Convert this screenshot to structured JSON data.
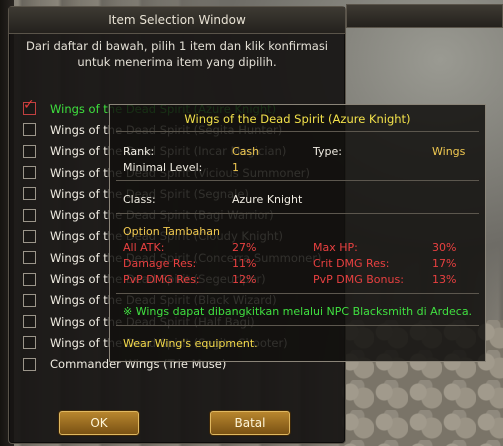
{
  "window": {
    "title": "Item Selection Window",
    "instructions": "Dari daftar di bawah, pilih 1 item dan klik konfirmasi untuk menerima item yang dipilih.",
    "items": [
      {
        "label": "Wings of the Dead Spirit (Azure Knight)",
        "checked": true
      },
      {
        "label": "Wings of the Dead Spirit (Segita Hunter)",
        "checked": false
      },
      {
        "label": "Wings of the Dead Spirit (Incar Magician)",
        "checked": false
      },
      {
        "label": "Wings of the Dead Spirit (Vicious Summoner)",
        "checked": false
      },
      {
        "label": "Wings of the Dead Spirit (Segnale)",
        "checked": false
      },
      {
        "label": "Wings of the Dead Spirit (Bagi Warrior)",
        "checked": false
      },
      {
        "label": "Wings of the Dead Spirit (Cloudy Knight)",
        "checked": false
      },
      {
        "label": "Wings of the Dead Spirit (Concerra Summoner)",
        "checked": false
      },
      {
        "label": "Wings of the Dead Spirit (Segeuriper)",
        "checked": false
      },
      {
        "label": "Wings of the Dead Spirit (Black Wizard)",
        "checked": false
      },
      {
        "label": "Wings of the Dead Spirit (Half Bagi)",
        "checked": false
      },
      {
        "label": "Wings of the Dead Spirit (Segita Shooter)",
        "checked": false
      },
      {
        "label": "Commander Wings (Trie Muse)",
        "checked": false
      }
    ],
    "ok_label": "OK",
    "cancel_label": "Batal"
  },
  "tooltip": {
    "title": "Wings of the Dead Spirit (Azure Knight)",
    "rank_label": "Rank:",
    "rank_value": "Cash",
    "type_label": "Type:",
    "type_value": "Wings",
    "minlevel_label": "Minimal Level:",
    "minlevel_value": "1",
    "class_label": "Class:",
    "class_value": "Azure Knight",
    "option_header": "Option Tambahan",
    "options": [
      {
        "label": "All ATK:",
        "value": "27%"
      },
      {
        "label": "Max HP:",
        "value": "30%"
      },
      {
        "label": "Damage Res:",
        "value": "11%"
      },
      {
        "label": "Crit DMG Res:",
        "value": "17%"
      },
      {
        "label": "PvP DMG Res:",
        "value": "12%"
      },
      {
        "label": "PvP DMG Bonus:",
        "value": "13%"
      }
    ],
    "note": "※ Wings dapat dibangkitkan melalui NPC Blacksmith di Ardeca.",
    "equip_note": "Wear Wing's equipment."
  },
  "colors": {
    "title_yellow": "#f2e14a",
    "stat_red": "#e84040",
    "note_green": "#40e040",
    "button_gold": "#b8862e"
  }
}
